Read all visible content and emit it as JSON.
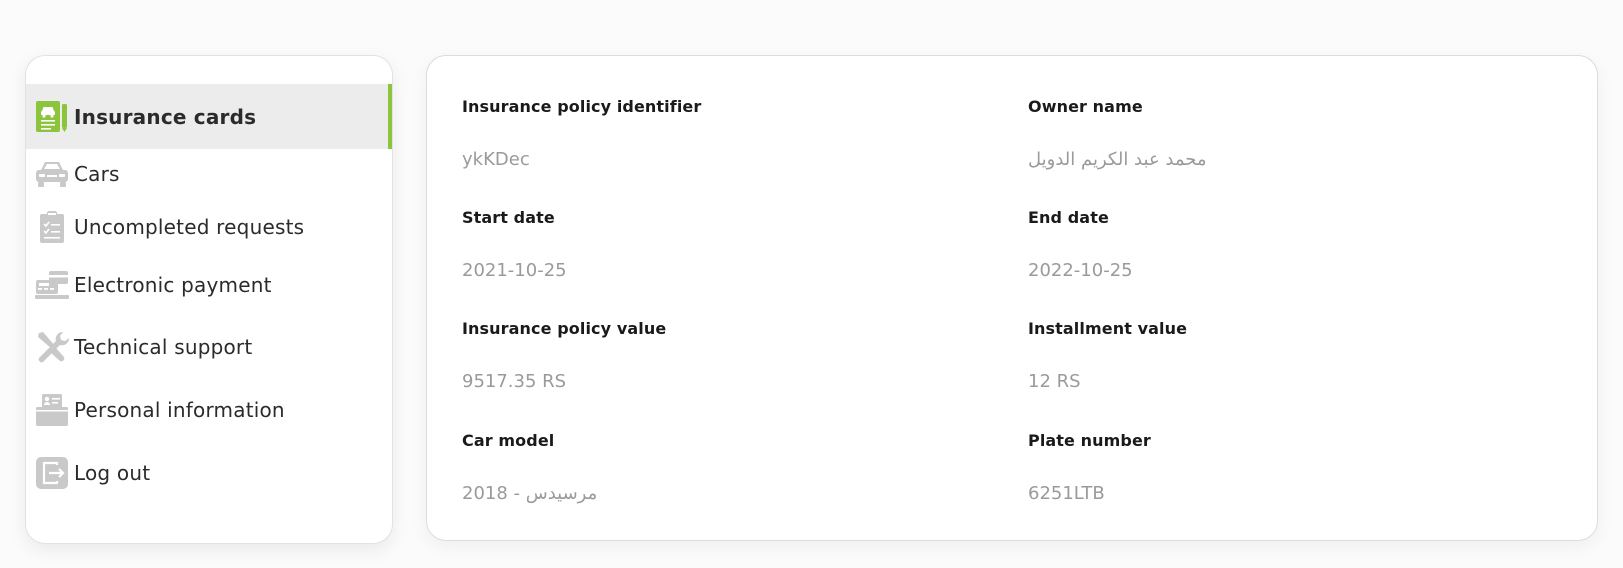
{
  "sidebar": {
    "accent_color": "#8cc43c",
    "items": [
      {
        "label": "Insurance cards",
        "icon": "insurance-card-icon",
        "active": true
      },
      {
        "label": "Cars",
        "icon": "car-icon",
        "active": false
      },
      {
        "label": "Uncompleted requests",
        "icon": "clipboard-checklist-icon",
        "active": false
      },
      {
        "label": "Electronic payment",
        "icon": "payment-terminal-icon",
        "active": false
      },
      {
        "label": "Technical support",
        "icon": "tools-icon",
        "active": false
      },
      {
        "label": "Personal information",
        "icon": "id-card-icon",
        "active": false
      },
      {
        "label": "Log out",
        "icon": "logout-icon",
        "active": false
      }
    ]
  },
  "details": {
    "policy_id": {
      "label": "Insurance policy identifier",
      "value": "ykKDec"
    },
    "owner_name": {
      "label": "Owner name",
      "value": "محمد عبد الكريم الدويل"
    },
    "start_date": {
      "label": "Start date",
      "value": "2021-10-25"
    },
    "end_date": {
      "label": "End date",
      "value": "2022-10-25"
    },
    "policy_value": {
      "label": "Insurance policy value",
      "value": "9517.35 RS"
    },
    "installment_value": {
      "label": "Installment value",
      "value": "12 RS"
    },
    "car_model": {
      "label": "Car model",
      "value": "2018 - مرسيدس"
    },
    "plate_number": {
      "label": "Plate number",
      "value": "6251LTB"
    }
  }
}
